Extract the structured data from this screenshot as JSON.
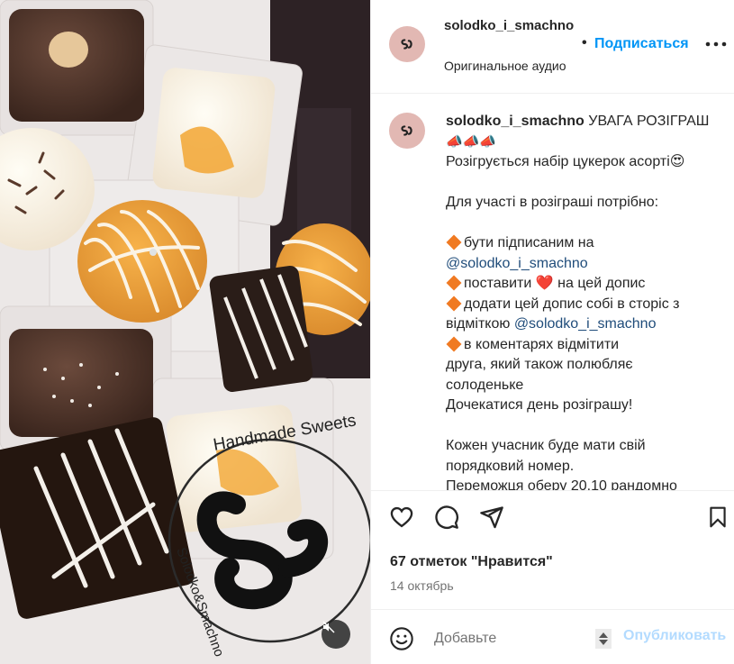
{
  "media": {
    "watermark_text": "Handmade Sweets",
    "watermark_bottom": "Solodko&Smachno",
    "mute_icon": "speaker-muted-icon"
  },
  "header": {
    "username": "solodko_i_smachno",
    "separator": "•",
    "follow_label": "Подписаться",
    "audio_label": "Оригинальное аудио",
    "more_icon": "more-horizontal-icon"
  },
  "caption": {
    "username": "solodko_i_smachno",
    "title": "УВАГА РОЗІГРАШ",
    "megaphones": "📣📣📣",
    "line1": "Розігрується набір цукерок асорті😍",
    "line2": "Для участі в розіграші потрібно:",
    "rule1_a": "бути підписаним на",
    "rule1_mention": "@solodko_i_smachno",
    "rule2_a": "поставити",
    "rule2_heart": "❤️",
    "rule2_b": "на цей допис",
    "rule3_a": "додати цей допис собі в сторіс з відміткою",
    "rule3_mention": "@solodko_i_smachno",
    "rule4_a": "в коментарях відмітити",
    "rule4_b": "друга, який також полюбляє",
    "rule4_c": "солоденьке",
    "line3": "Дочекатися день розіграшу!",
    "line4": "Кожен учасник буде мати свій",
    "line5": "порядковий номер.",
    "line6": "Переможця оберу 20.10 рандомно"
  },
  "actions": {
    "like_icon": "heart-icon",
    "comment_icon": "comment-icon",
    "share_icon": "send-icon",
    "save_icon": "bookmark-icon"
  },
  "likes_text": "67 отметок \"Нравится\"",
  "date_text": "14 октябрь",
  "comment": {
    "emoji_icon": "emoji-smile-icon",
    "placeholder": "Добавьте",
    "publish_label": "Опубликовать"
  },
  "colors": {
    "accent": "#0095f6",
    "mention": "#1f4c7a",
    "avatar_bg": "#e2b8b3",
    "publish_disabled": "#b3dbff"
  }
}
